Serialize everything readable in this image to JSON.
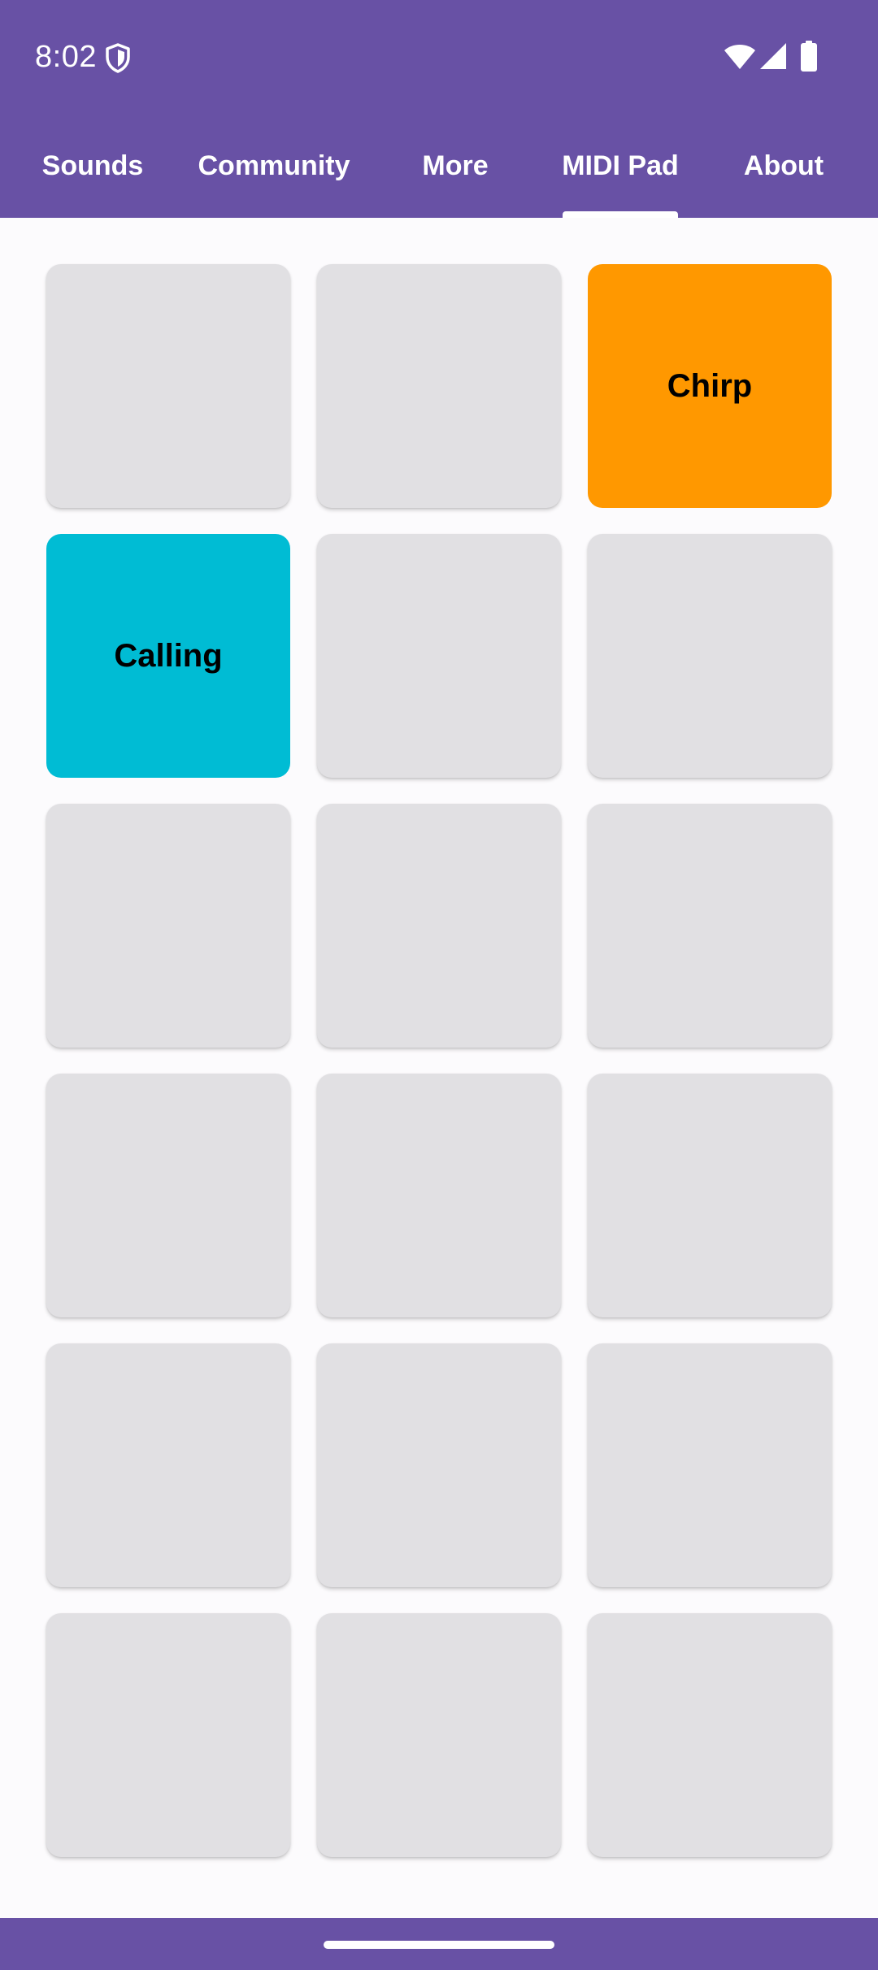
{
  "status_bar": {
    "time": "8:02",
    "icons": [
      "shield-icon",
      "wifi-icon",
      "signal-icon",
      "battery-icon"
    ]
  },
  "tabs": [
    {
      "label": "Sounds",
      "selected": false
    },
    {
      "label": "Community",
      "selected": false
    },
    {
      "label": "More",
      "selected": false
    },
    {
      "label": "MIDI Pad",
      "selected": true
    },
    {
      "label": "About",
      "selected": false
    }
  ],
  "pads": [
    {
      "label": "",
      "color": ""
    },
    {
      "label": "",
      "color": ""
    },
    {
      "label": "Chirp",
      "color": "#FF9800"
    },
    {
      "label": "Calling",
      "color": "#00BCD4"
    },
    {
      "label": "",
      "color": ""
    },
    {
      "label": "",
      "color": ""
    },
    {
      "label": "",
      "color": ""
    },
    {
      "label": "",
      "color": ""
    },
    {
      "label": "",
      "color": ""
    },
    {
      "label": "",
      "color": ""
    },
    {
      "label": "",
      "color": ""
    },
    {
      "label": "",
      "color": ""
    },
    {
      "label": "",
      "color": ""
    },
    {
      "label": "",
      "color": ""
    },
    {
      "label": "",
      "color": ""
    },
    {
      "label": "",
      "color": ""
    },
    {
      "label": "",
      "color": ""
    },
    {
      "label": "",
      "color": ""
    }
  ],
  "colors": {
    "primary": "#6851A5",
    "pad_empty": "#E1E0E3",
    "background": "#FCFBFD",
    "on_primary": "#FFFFFF"
  }
}
